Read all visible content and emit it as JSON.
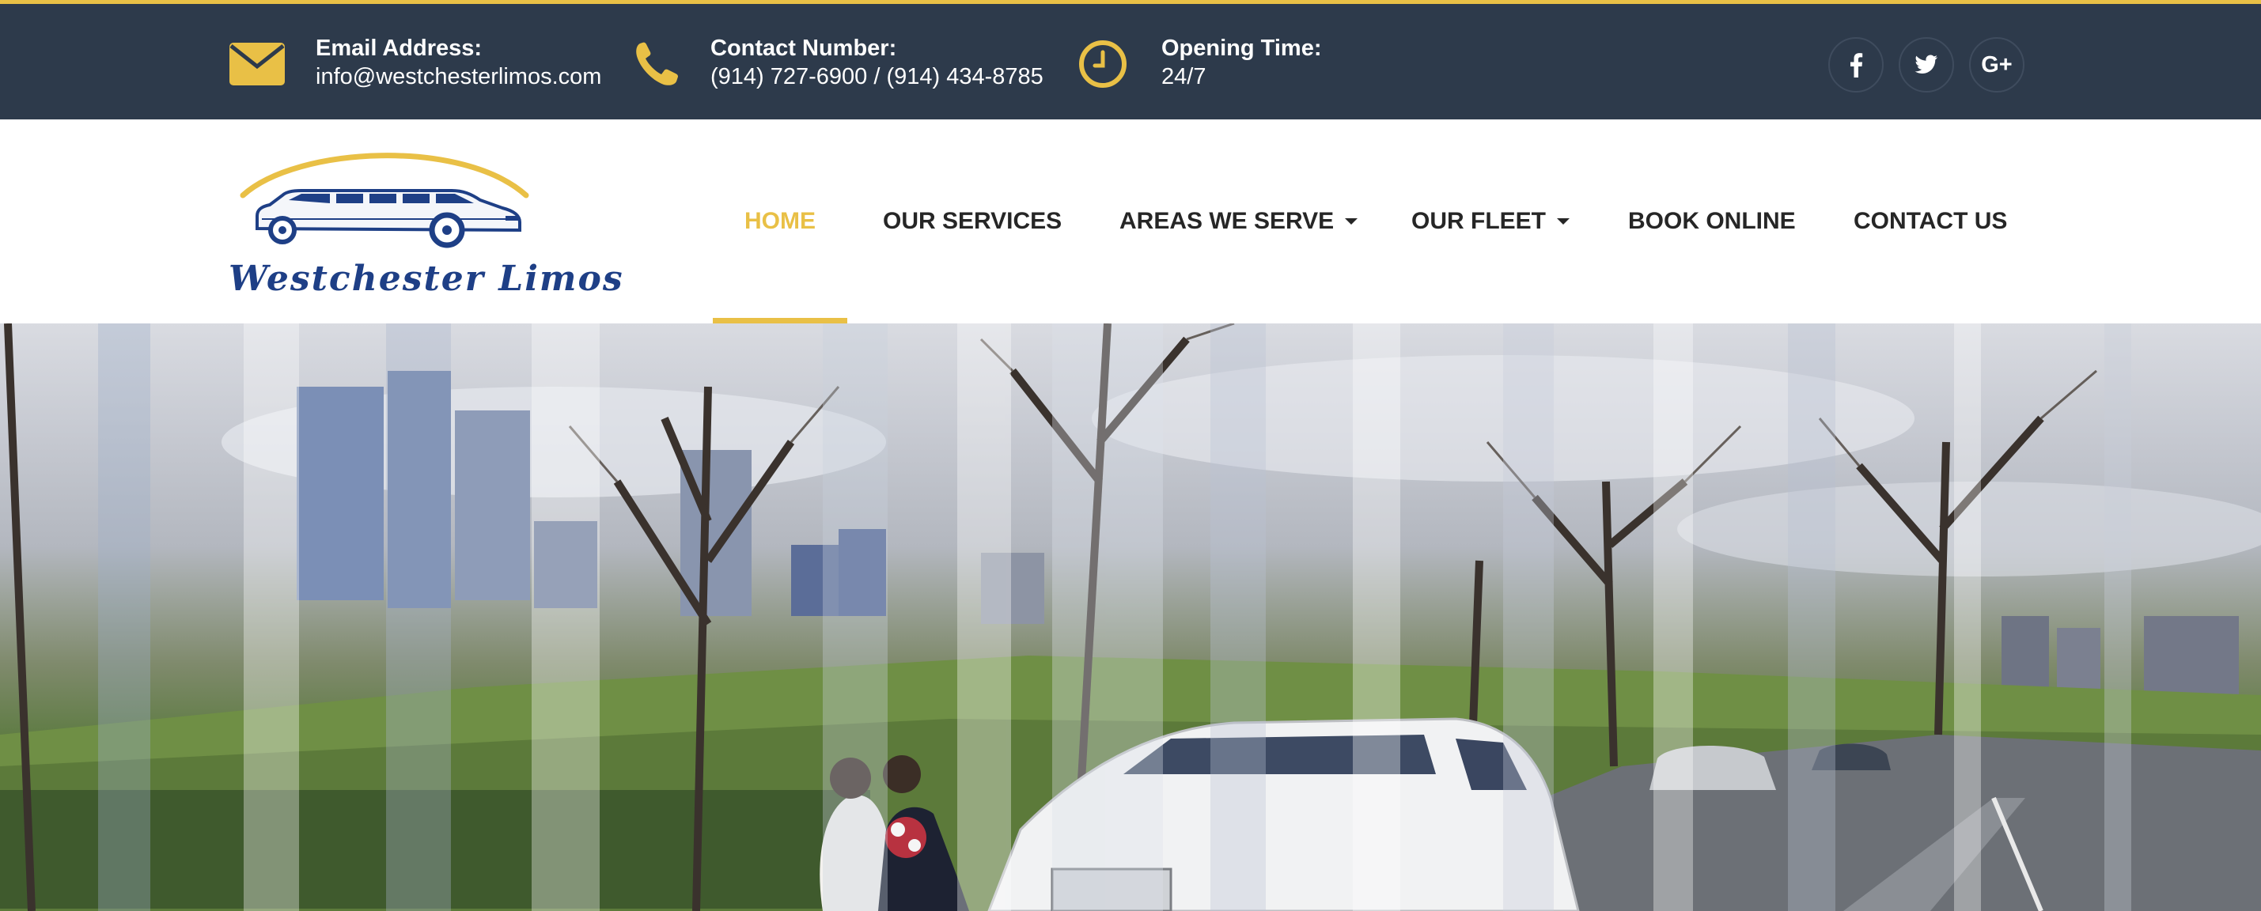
{
  "topbar": {
    "email": {
      "label": "Email Address:",
      "value": "info@westchesterlimos.com",
      "icon": "envelope-icon"
    },
    "phone": {
      "label": "Contact Number:",
      "value": "(914) 727-6900 / (914) 434-8785",
      "icon": "phone-icon"
    },
    "hours": {
      "label": "Opening Time:",
      "value": "24/7",
      "icon": "clock-icon"
    },
    "social": [
      {
        "name": "facebook",
        "glyph": "f"
      },
      {
        "name": "twitter",
        "glyph": "t"
      },
      {
        "name": "google-plus",
        "glyph": "G+"
      }
    ]
  },
  "logo": {
    "text": "Westchester Limos"
  },
  "nav": {
    "items": [
      {
        "label": "HOME",
        "active": true
      },
      {
        "label": "OUR SERVICES"
      },
      {
        "label": "AREAS WE SERVE",
        "dropdown": true
      },
      {
        "label": "OUR FLEET",
        "dropdown": true
      },
      {
        "label": "BOOK ONLINE"
      },
      {
        "label": "CONTACT US"
      }
    ]
  },
  "colors": {
    "topbar_bg": "#2d3a4b",
    "accent": "#e9c046",
    "nav_text": "#262626",
    "logo_blue": "#1e3f86"
  }
}
